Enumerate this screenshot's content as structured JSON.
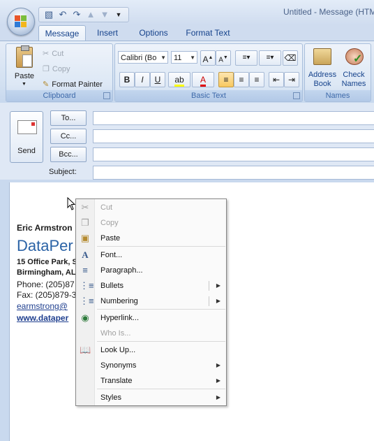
{
  "window": {
    "title": "Untitled - Message (HTM"
  },
  "quick_access": {
    "icons": [
      "save-icon",
      "undo-icon",
      "redo-icon",
      "up-arrow-icon",
      "down-arrow-icon",
      "customize-icon"
    ]
  },
  "tabs": [
    "Message",
    "Insert",
    "Options",
    "Format Text"
  ],
  "ribbon": {
    "clipboard": {
      "label": "Clipboard",
      "paste": "Paste",
      "cut": "Cut",
      "copy": "Copy",
      "format_painter": "Format Painter"
    },
    "basic_text": {
      "label": "Basic Text",
      "font": "Calibri (Bo",
      "size": "11"
    },
    "names": {
      "label": "Names",
      "address_book_1": "Address",
      "address_book_2": "Book",
      "check_names_1": "Check",
      "check_names_2": "Names"
    }
  },
  "compose": {
    "send": "Send",
    "to": "To...",
    "cc": "Cc...",
    "bcc": "Bcc...",
    "subject": "Subject:"
  },
  "signature": {
    "name": "Eric Armstron",
    "company": "DataPer",
    "address1": "15 Office Park, S",
    "address2": "Birmingham, AL",
    "phone": "Phone: (205)87",
    "fax": "Fax: (205)879-3",
    "email": "earmstrong@",
    "web": "www.dataper"
  },
  "context_menu": {
    "items": [
      {
        "label": "Cut",
        "icon": "scissors-icon",
        "disabled": true
      },
      {
        "label": "Copy",
        "icon": "copy-icon",
        "disabled": true
      },
      {
        "label": "Paste",
        "icon": "paste-icon",
        "disabled": false
      },
      {
        "label": "Font...",
        "icon": "font-icon",
        "disabled": false
      },
      {
        "label": "Paragraph...",
        "icon": "paragraph-icon",
        "disabled": false
      },
      {
        "label": "Bullets",
        "icon": "bullets-icon",
        "disabled": false,
        "submenu": true
      },
      {
        "label": "Numbering",
        "icon": "numbering-icon",
        "disabled": false,
        "submenu": true
      },
      {
        "label": "Hyperlink...",
        "icon": "hyperlink-icon",
        "disabled": false
      },
      {
        "label": "Who Is...",
        "icon": "",
        "disabled": true
      },
      {
        "label": "Look Up...",
        "icon": "research-icon",
        "disabled": false
      },
      {
        "label": "Synonyms",
        "icon": "",
        "disabled": false,
        "submenu": true
      },
      {
        "label": "Translate",
        "icon": "",
        "disabled": false,
        "submenu": true
      },
      {
        "label": "Styles",
        "icon": "",
        "disabled": false,
        "submenu": true
      }
    ]
  },
  "colors": {
    "ribbon_blue": "#15428b",
    "link": "#1f3f8f",
    "company": "#2b63a6"
  }
}
